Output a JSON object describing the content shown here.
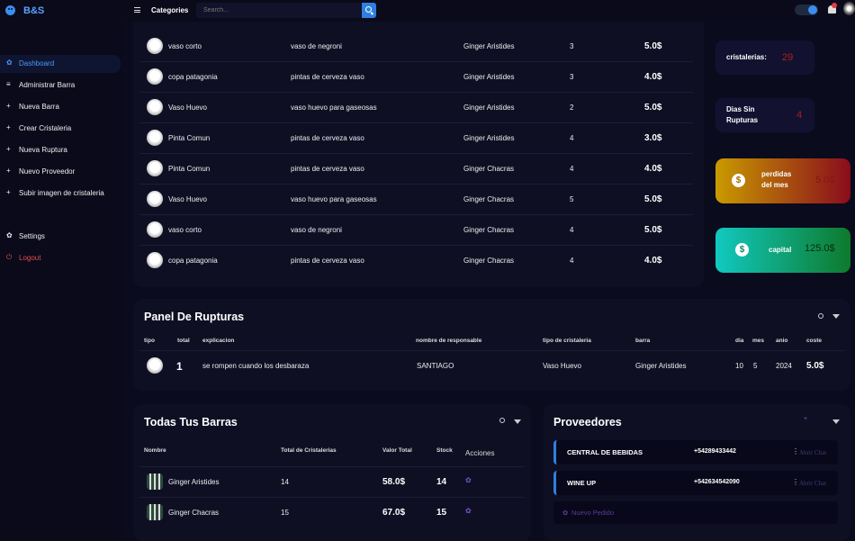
{
  "app": {
    "brand": "B&S"
  },
  "topbar": {
    "categories": "Categories",
    "search_placeholder": "Search..."
  },
  "sidebar": {
    "items": [
      {
        "label": "Dashboard",
        "icon": "gear-icon"
      },
      {
        "label": "Administrar Barra",
        "icon": "menu-icon"
      },
      {
        "label": "Nueva Barra",
        "icon": "plus-icon"
      },
      {
        "label": "Crear Cristaleria",
        "icon": "plus-icon"
      },
      {
        "label": "Nueva Ruptura",
        "icon": "plus-icon"
      },
      {
        "label": "Nuevo Proveedor",
        "icon": "plus-icon"
      },
      {
        "label": "Subir imagen de cristaleria",
        "icon": "plus-icon"
      },
      {
        "label": "Settings",
        "icon": "gear-icon"
      },
      {
        "label": "Logout",
        "icon": "power-icon"
      }
    ]
  },
  "glass_rows": [
    {
      "name": "vaso corto",
      "desc": "vaso de negroni",
      "bar": "Ginger Aristides",
      "qty": "3",
      "price": "5.0$"
    },
    {
      "name": "copa patagonia",
      "desc": "pintas de cerveza vaso",
      "bar": "Ginger Aristides",
      "qty": "3",
      "price": "4.0$"
    },
    {
      "name": "Vaso Huevo",
      "desc": "vaso huevo para gaseosas",
      "bar": "Ginger Aristides",
      "qty": "2",
      "price": "5.0$"
    },
    {
      "name": "Pinta Comun",
      "desc": "pintas de cerveza vaso",
      "bar": "Ginger Aristides",
      "qty": "4",
      "price": "3.0$"
    },
    {
      "name": "Pinta Comun",
      "desc": "pintas de cerveza vaso",
      "bar": "Ginger Chacras",
      "qty": "4",
      "price": "4.0$"
    },
    {
      "name": "Vaso Huevo",
      "desc": "vaso huevo para gaseosas",
      "bar": "Ginger Chacras",
      "qty": "5",
      "price": "5.0$"
    },
    {
      "name": "vaso corto",
      "desc": "vaso de negroni",
      "bar": "Ginger Chacras",
      "qty": "4",
      "price": "5.0$"
    },
    {
      "name": "copa patagonia",
      "desc": "pintas de cerveza vaso",
      "bar": "Ginger Chacras",
      "qty": "4",
      "price": "4.0$"
    }
  ],
  "stats": {
    "cristalerias": {
      "label": "cristalerias:",
      "value": "29"
    },
    "dias": {
      "label_1": "Dias Sin",
      "label_2": "Rupturas",
      "value": "4"
    },
    "perdidas": {
      "label_1": "perdidas",
      "label_2": "del mes",
      "value": "5.0$"
    },
    "capital": {
      "label": "capital",
      "value": "125.0$"
    }
  },
  "rupturas": {
    "title": "Panel De Rupturas",
    "headers": [
      "tipo",
      "total",
      "explicacion",
      "nombre de responsable",
      "tipo de cristaleria",
      "barra",
      "dia",
      "mes",
      "anio",
      "coste"
    ],
    "rows": [
      {
        "total": "1",
        "explicacion": "se rompen cuando los desbaraza",
        "responsable": "SANTIAGO",
        "tipo": "Vaso Huevo",
        "barra": "Ginger Aristides",
        "dia": "10",
        "mes": "5",
        "anio": "2024",
        "coste": "5.0$"
      }
    ]
  },
  "barras": {
    "title": "Todas Tus Barras",
    "headers": [
      "Nombre",
      "Total de Cristalerias",
      "Valor Total",
      "Stock",
      "Acciones"
    ],
    "rows": [
      {
        "name": "Ginger Aristides",
        "total": "14",
        "valor": "58.0$",
        "stock": "14"
      },
      {
        "name": "Ginger Chacras",
        "total": "15",
        "valor": "67.0$",
        "stock": "15"
      }
    ]
  },
  "proveedores": {
    "title": "Proveedores",
    "items": [
      {
        "name": "CENTRAL DE BEBIDAS",
        "phone": "+54289433442",
        "link": "Abrir Chat"
      },
      {
        "name": "WINE UP",
        "phone": "+542634542090",
        "link": "Abrir Chat"
      }
    ],
    "new_order": "Nuevo Pedido"
  },
  "colors": {
    "accent": "#2f7fe0",
    "background": "#0b0b1e",
    "panel": "#0f0f24",
    "danger": "#e54b4b",
    "perdidas_gradient": [
      "#c99a00",
      "#8a0c1c"
    ],
    "capital_gradient": [
      "#11c9c0",
      "#0e7a2c"
    ]
  }
}
